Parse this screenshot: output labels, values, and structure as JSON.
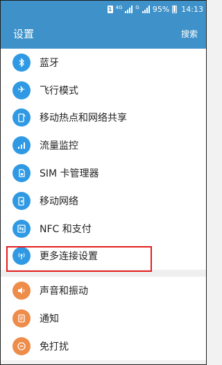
{
  "status_bar": {
    "sim": "1",
    "network": "4G",
    "signal_note": "G",
    "battery": "95%",
    "time": "14:13"
  },
  "header": {
    "title": "设置",
    "search": "搜索"
  },
  "colors": {
    "primary": "#3f92c9",
    "icon_blue": "#2f9ae3",
    "icon_orange": "#ee8c49",
    "highlight": "#e51d1d"
  },
  "sections": [
    {
      "items": [
        {
          "label": "蓝牙",
          "icon": "bluetooth-icon"
        },
        {
          "label": "飞行模式",
          "icon": "airplane-icon"
        },
        {
          "label": "移动热点和网络共享",
          "icon": "hotspot-icon"
        },
        {
          "label": "流量监控",
          "icon": "data-usage-icon"
        },
        {
          "label": "SIM 卡管理器",
          "icon": "sim-card-icon"
        },
        {
          "label": "移动网络",
          "icon": "mobile-network-icon"
        },
        {
          "label": "NFC 和支付",
          "icon": "nfc-icon"
        },
        {
          "label": "更多连接设置",
          "icon": "more-connections-icon",
          "highlighted": true
        }
      ]
    },
    {
      "items": [
        {
          "label": "声音和振动",
          "icon": "sound-icon"
        },
        {
          "label": "通知",
          "icon": "notification-icon"
        },
        {
          "label": "免打扰",
          "icon": "do-not-disturb-icon"
        }
      ]
    }
  ]
}
